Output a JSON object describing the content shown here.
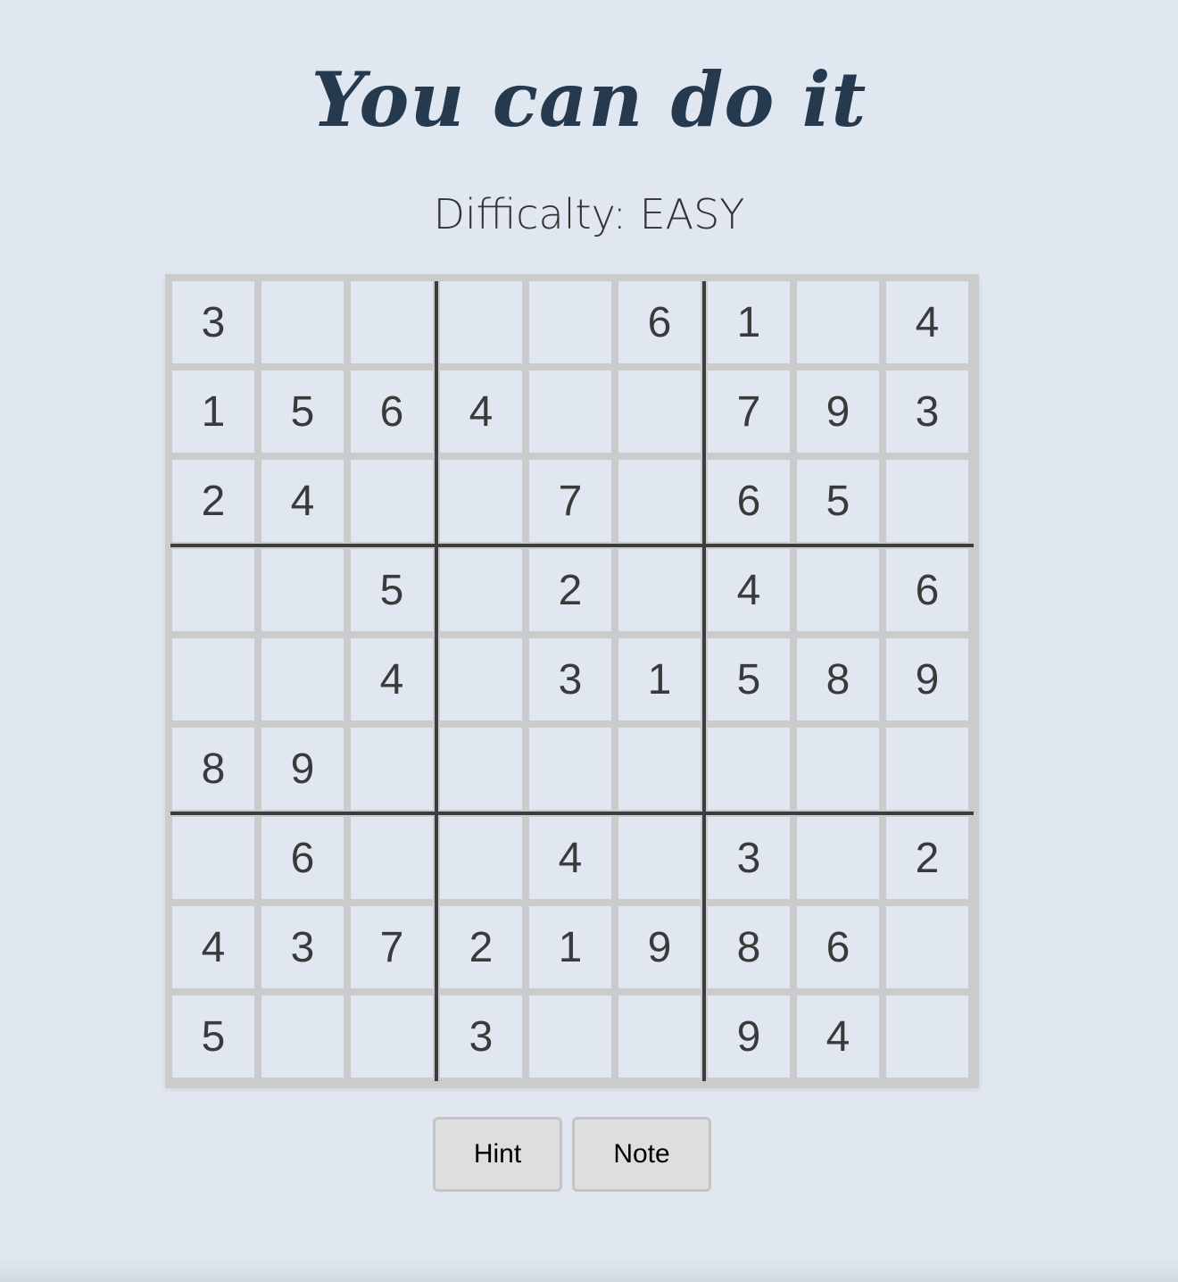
{
  "header": {
    "title": "You can do it",
    "difficulty_label": "Difficalty:",
    "difficulty_value": "EASY"
  },
  "board": {
    "rows": [
      [
        "3",
        "",
        "",
        "",
        "",
        "6",
        "1",
        "",
        "4"
      ],
      [
        "1",
        "5",
        "6",
        "4",
        "",
        "",
        "7",
        "9",
        "3"
      ],
      [
        "2",
        "4",
        "",
        "",
        "7",
        "",
        "6",
        "5",
        ""
      ],
      [
        "",
        "",
        "5",
        "",
        "2",
        "",
        "4",
        "",
        "6"
      ],
      [
        "",
        "",
        "4",
        "",
        "3",
        "1",
        "5",
        "8",
        "9"
      ],
      [
        "8",
        "9",
        "",
        "",
        "",
        "",
        "",
        "",
        ""
      ],
      [
        "",
        "6",
        "",
        "",
        "4",
        "",
        "3",
        "",
        "2"
      ],
      [
        "4",
        "3",
        "7",
        "2",
        "1",
        "9",
        "8",
        "6",
        ""
      ],
      [
        "5",
        "",
        "",
        "3",
        "",
        "",
        "9",
        "4",
        ""
      ]
    ]
  },
  "controls": {
    "hint_label": "Hint",
    "note_label": "Note"
  },
  "colors": {
    "background": "#e0e7f0",
    "title": "#263a4f",
    "cell_text": "#3a3a3a",
    "grid_thin": "#cbcbcb",
    "grid_thick": "#3d3d3d"
  }
}
